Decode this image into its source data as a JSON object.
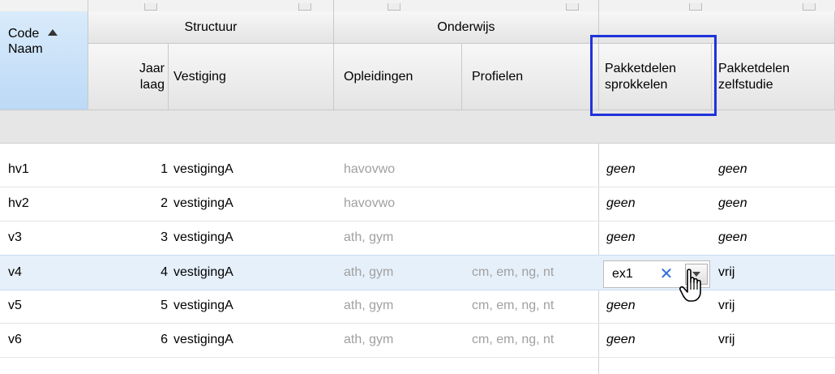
{
  "header": {
    "groups": {
      "structuur": "Structuur",
      "onderwijs": "Onderwijs"
    },
    "code_line1": "Code",
    "code_line2": "Naam",
    "jaar_line1": "Jaar",
    "jaar_line2": "laag",
    "vestiging": "Vestiging",
    "opleidingen": "Opleidingen",
    "profielen": "Profielen",
    "pakket_sprokkelen_1": "Pakketdelen",
    "pakket_sprokkelen_2": "sprokkelen",
    "pakket_zelfstudie_1": "Pakketdelen",
    "pakket_zelfstudie_2": "zelfstudie"
  },
  "rows": [
    {
      "code": "hv1",
      "jaar": "1",
      "vestiging": "vestigingA",
      "opleidingen": "havovwo",
      "profielen": "",
      "sprokkelen": "geen",
      "zelfstudie": "geen"
    },
    {
      "code": "hv2",
      "jaar": "2",
      "vestiging": "vestigingA",
      "opleidingen": "havovwo",
      "profielen": "",
      "sprokkelen": "geen",
      "zelfstudie": "geen"
    },
    {
      "code": "v3",
      "jaar": "3",
      "vestiging": "vestigingA",
      "opleidingen": "ath, gym",
      "profielen": "",
      "sprokkelen": "geen",
      "zelfstudie": "geen"
    },
    {
      "code": "v4",
      "jaar": "4",
      "vestiging": "vestigingA",
      "opleidingen": "ath, gym",
      "profielen": "cm, em, ng, nt",
      "sprokkelen": "ex1",
      "zelfstudie": "vrij"
    },
    {
      "code": "v5",
      "jaar": "5",
      "vestiging": "vestigingA",
      "opleidingen": "ath, gym",
      "profielen": "cm, em, ng, nt",
      "sprokkelen": "geen",
      "zelfstudie": "vrij"
    },
    {
      "code": "v6",
      "jaar": "6",
      "vestiging": "vestigingA",
      "opleidingen": "ath, gym",
      "profielen": "cm, em, ng, nt",
      "sprokkelen": "geen",
      "zelfstudie": "vrij"
    }
  ],
  "editor": {
    "value": "ex1",
    "clear_glyph": "✕"
  },
  "icons": {
    "sort": "sort-ascending-icon",
    "clear": "clear-icon",
    "dropdown": "dropdown-arrow-icon",
    "cursor": "hand-pointer-icon"
  },
  "colors": {
    "highlight_border": "#1f33d9",
    "selected_row": "#e6f0fb",
    "sorted_header": "#bcd9f6"
  }
}
